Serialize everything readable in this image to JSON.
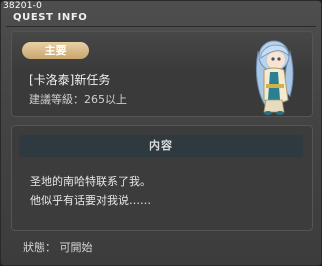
{
  "window": {
    "id_label": "38201-0",
    "title": "QUEST INFO"
  },
  "summary": {
    "tag": "主要",
    "quest_name": "[卡洛泰]新任务",
    "level_requirement": "建議等級：265以上"
  },
  "content": {
    "header": "内容",
    "lines": [
      "圣地的南哈特联系了我。",
      "他似乎有话要对我说……"
    ]
  },
  "status_text": "狀態： 可開始",
  "colors": {
    "tag_pill": "#d8bb88",
    "content_header": "#2f3a40",
    "npc_hair": "#a9c6e4",
    "npc_robe": "#2a7f93"
  }
}
